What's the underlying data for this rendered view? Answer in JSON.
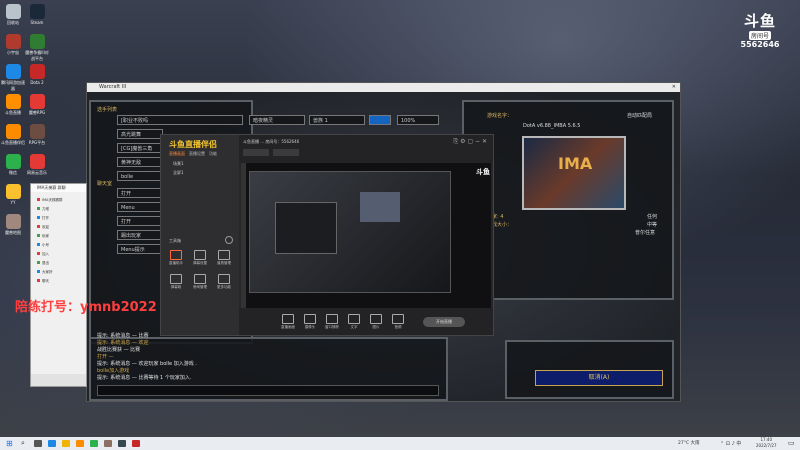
{
  "brand": {
    "logo_text": "斗鱼",
    "badge": "房间号",
    "room_number": "5562646"
  },
  "desktop_icons": [
    {
      "label": "回收站",
      "color": "#b9c3cc"
    },
    {
      "label": "Steam",
      "color": "#1b2838"
    },
    {
      "label": "小宇宙",
      "color": "#b03a2e"
    },
    {
      "label": "魔兽争霸III对战平台",
      "color": "#2e7d32"
    },
    {
      "label": "腾讯网游加速器",
      "color": "#1e88e5"
    },
    {
      "label": "Dota 2",
      "color": "#c62828"
    },
    {
      "label": "斗鱼直播",
      "color": "#ff8f00"
    },
    {
      "label": "魔兽RPG",
      "color": "#e53935"
    },
    {
      "label": "斗鱼直播伴侣",
      "color": "#fb8c00"
    },
    {
      "label": "RPG平台",
      "color": "#6d4c41"
    },
    {
      "label": "微信",
      "color": "#2bb24c"
    },
    {
      "label": "网易云音乐",
      "color": "#e53935"
    },
    {
      "label": "YY",
      "color": "#fbc02d"
    },
    {
      "label": "游戏",
      "color": "#8d6e63"
    },
    {
      "label": "魔兽地图",
      "color": "#a1887f"
    }
  ],
  "game_window": {
    "title": "Warcraft III",
    "left_menu_1_label": "选手列表",
    "left_menu_1": [
      "[职业不败吗",
      "高光跳舞",
      "[CG]魔兽三角",
      "黄神无敌",
      "bolle"
    ],
    "left_menu_2_label": "聊天室",
    "left_menu_2": [
      "打开",
      "Menu",
      "打开",
      "踢出玩家",
      "Menu提示"
    ],
    "top_fields": [
      "暗夜精灵",
      "兽族 1",
      "100%"
    ],
    "right_labels": {
      "game_name_label": "游戏名字：",
      "game_name": "DotA v6.88_IMBA 5.6.5",
      "mode": "自动匹配局"
    },
    "right_players": {
      "label": "玩家: 4",
      "sub": "游戏大小：",
      "field": "帐",
      "extra1": "任何",
      "extra2": "中等",
      "extra3": "普尔任意"
    },
    "chat_lines": [
      "提示: 系统消息 — 比赛",
      "提示: 系统消息 — 欢迎",
      "战胜比赛获 — 比赛",
      "打开 —",
      "提示: 系统消息 — 欢迎玩家 bolle 加入游戏 .",
      "bolle加入游戏",
      "提示: 系统消息 — 比赛等待 1 个玩家加入."
    ],
    "cancel_button": "取消(A)"
  },
  "stream_app": {
    "title": "斗鱼直播伴侣",
    "tabs": [
      "直播画面",
      "直播设置",
      "功能"
    ],
    "scene_items": [
      "场景1",
      "全屏1"
    ],
    "add_label": "添加",
    "tools_header": "工具箱",
    "tools": [
      "直播助手",
      "弹幕设置",
      "道具管理",
      "弹幕姬",
      "房间管理",
      "更多功能"
    ],
    "room_info": "斗鱼直播 ... 房间号：5562646",
    "bottom_tools": [
      "直播画面",
      "摄像头",
      "窗口捕获",
      "文字",
      "图片",
      "音频"
    ],
    "go_live": "开始直播"
  },
  "chat_window": {
    "title": "IMA天梯赛 群聊",
    "lines": [
      "IMA天梯赛群",
      "刀塔",
      "打开",
      "欢迎",
      "玩家",
      "小号",
      "加入",
      "退出",
      "大家好",
      "聊天"
    ]
  },
  "watermark": "陪练打号：ymnb2022",
  "taskbar": {
    "search_icon": "search-icon",
    "weather": "27°C 大雨",
    "time": "17:40",
    "date": "2022/7/27"
  }
}
